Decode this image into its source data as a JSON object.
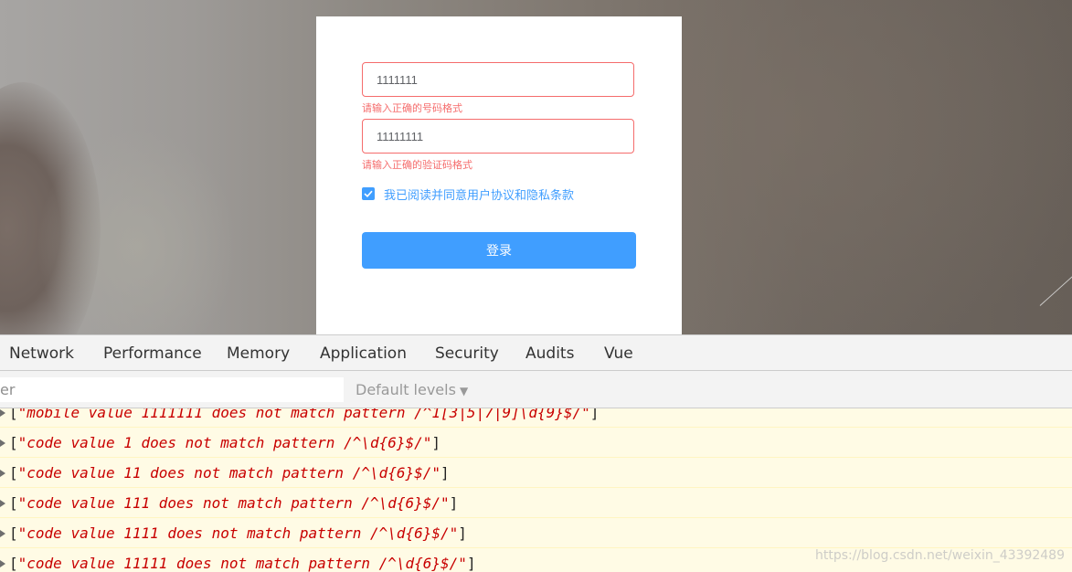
{
  "login": {
    "phone_value": "1111111",
    "phone_error": "请输入正确的号码格式",
    "code_value": "11111111",
    "code_error": "请输入正确的验证码格式",
    "agree_label": "我已阅读并同意用户协议和隐私条款",
    "agree_checked": true,
    "submit_label": "登录"
  },
  "devtools": {
    "tabs": [
      "Network",
      "Performance",
      "Memory",
      "Application",
      "Security",
      "Audits",
      "Vue"
    ],
    "filter_placeholder": "er",
    "levels_label": "Default levels"
  },
  "console": {
    "logs": [
      "mobile value 1111111 does not match pattern /^1[3|5|7|9]\\d{9}$/",
      "code value 1 does not match pattern /^\\d{6}$/",
      "code value 11 does not match pattern /^\\d{6}$/",
      "code value 111 does not match pattern /^\\d{6}$/",
      "code value 1111 does not match pattern /^\\d{6}$/",
      "code value 11111 does not match pattern /^\\d{6}$/"
    ]
  },
  "watermark": "https://blog.csdn.net/weixin_43392489",
  "colors": {
    "primary": "#409eff",
    "error": "#f56c6c",
    "console_warning_bg": "#fffbe5",
    "console_text": "#c80000"
  }
}
